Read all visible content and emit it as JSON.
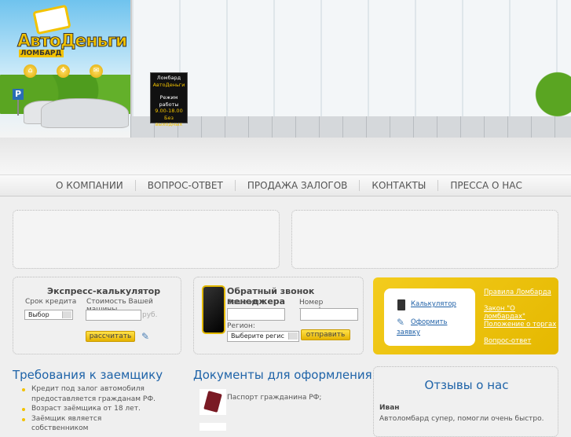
{
  "header": {
    "logo_main": "АвтоДеньги",
    "logo_sub": "ЛОМБАРД",
    "parking": "P",
    "sign": {
      "line1": "Ломбард",
      "line2": "АвтоДеньги",
      "line3": "Режим работы",
      "line4": "9.00-18.00",
      "line5": "Без выходных"
    }
  },
  "nav": [
    "О КОМПАНИИ",
    "ВОПРОС-ОТВЕТ",
    "ПРОДАЖА ЗАЛОГОВ",
    "КОНТАКТЫ",
    "ПРЕССА О НАС"
  ],
  "calculator": {
    "title": "Экспресс-калькулятор",
    "term_label": "Срок кредита",
    "term_value": "Выбор",
    "price_label": "Стоимость Вашей машины",
    "price_value": "",
    "currency": "руб.",
    "submit": "рассчитать"
  },
  "callback": {
    "title": "Обратный звонок менеджера",
    "name_label": "Ваше имя:",
    "phone_label": "Номер телефона:",
    "region_label": "Регион:",
    "region_value": "Выберите регис",
    "submit": "отправить"
  },
  "quick_links": {
    "calc": "Калькулятор",
    "apply": "Оформить заявку",
    "rules": "Правила Ломбарда",
    "law": "Закон \"О ломбардах\"",
    "auction": "Положение о торгах",
    "faq": "Вопрос-ответ"
  },
  "requirements": {
    "title": "Требования к заемщику",
    "items": [
      "Кредит под залог автомобиля предоставляется гражданам РФ.",
      "Возраст заёмщика от 18 лет.",
      "Заёмщик является собственником"
    ]
  },
  "documents": {
    "title": "Документы для оформления",
    "items": [
      "Паспорт гражданина РФ;"
    ]
  },
  "reviews": {
    "title": "Отзывы о нас",
    "author": "Иван",
    "text": "Автоломбард супер, помогли очень быстро."
  }
}
